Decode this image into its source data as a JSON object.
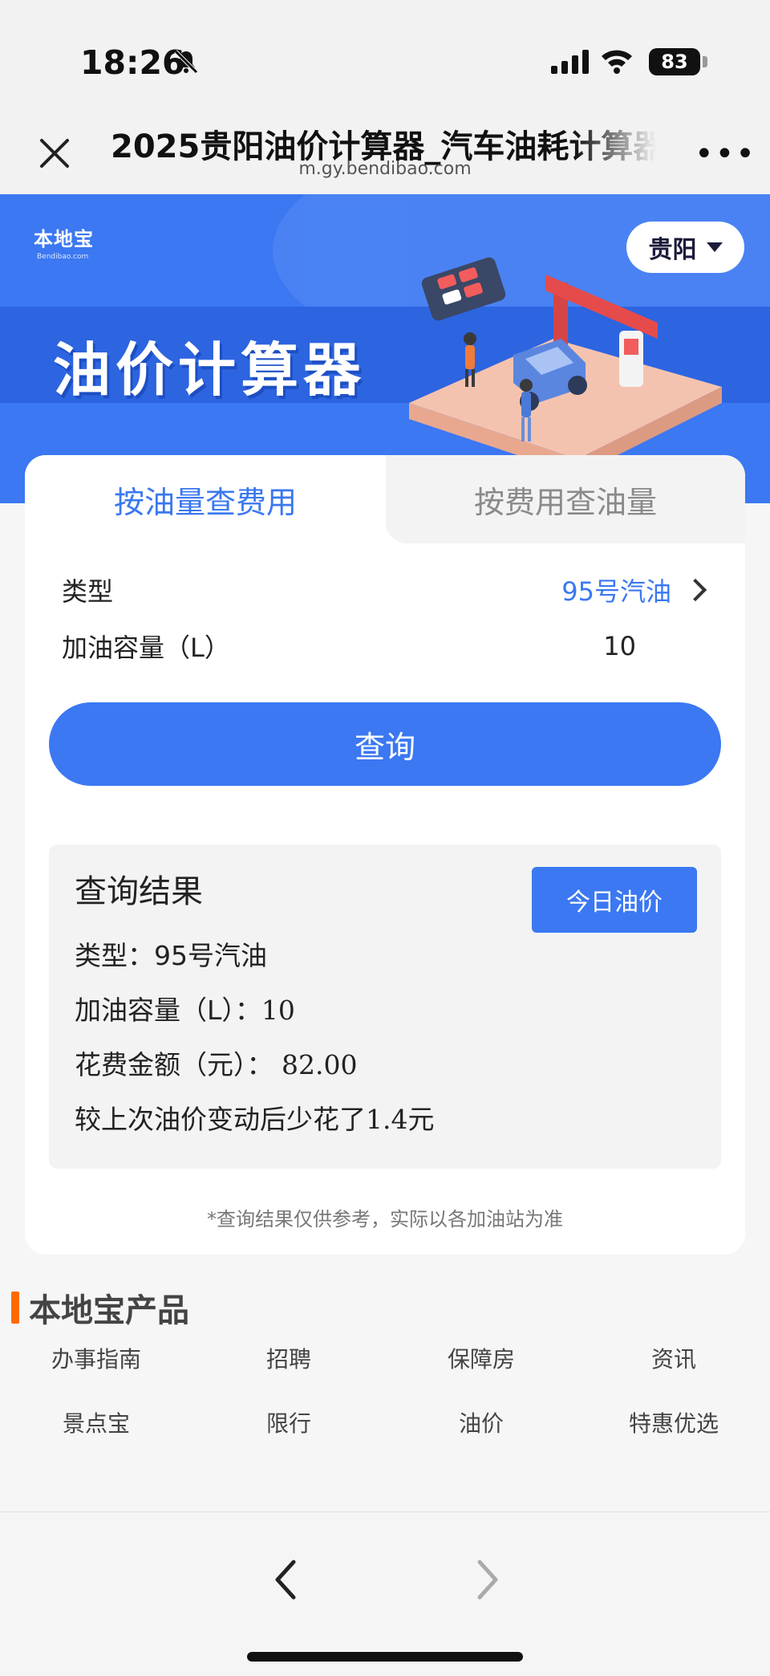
{
  "status_bar": {
    "time": "18:26",
    "battery": "83"
  },
  "browser": {
    "title": "2025贵阳油价计算器_汽车油耗计算器",
    "url": "m.gy.bendibao.com"
  },
  "banner": {
    "logo_text": "本地宝",
    "logo_sub": "Bendibao.com",
    "city": "贵阳",
    "title": "油价计算器"
  },
  "tabs": [
    {
      "label": "按油量查费用",
      "active": true
    },
    {
      "label": "按费用查油量",
      "active": false
    }
  ],
  "form": {
    "type_label": "类型",
    "type_value": "95号汽油",
    "volume_label": "加油容量（L）",
    "volume_value": "10",
    "query_button": "查询"
  },
  "result": {
    "title": "查询结果",
    "today_button": "今日油价",
    "type_label": "类型：",
    "type_value": "95号汽油",
    "volume_label": "加油容量（L）：",
    "volume_value": "10",
    "cost_label": "花费金额（元）：",
    "cost_value": "82.00",
    "change_text": "较上次油价变动后少花了",
    "change_value": "1.4",
    "change_unit": "元"
  },
  "disclaimer": "*查询结果仅供参考，实际以各加油站为准",
  "products": {
    "title": "本地宝产品",
    "items": [
      "办事指南",
      "招聘",
      "保障房",
      "资讯",
      "景点宝",
      "限行",
      "油价",
      "特惠优选"
    ]
  },
  "colors": {
    "accent": "#3b78f2",
    "tab_active": "#3a78f0",
    "section_bar": "#ff6a00"
  },
  "icons": [
    "bell-slash-icon",
    "signal-icon",
    "wifi-icon",
    "close-icon",
    "more-icon",
    "chevron-right-icon",
    "back-icon",
    "forward-icon"
  ]
}
